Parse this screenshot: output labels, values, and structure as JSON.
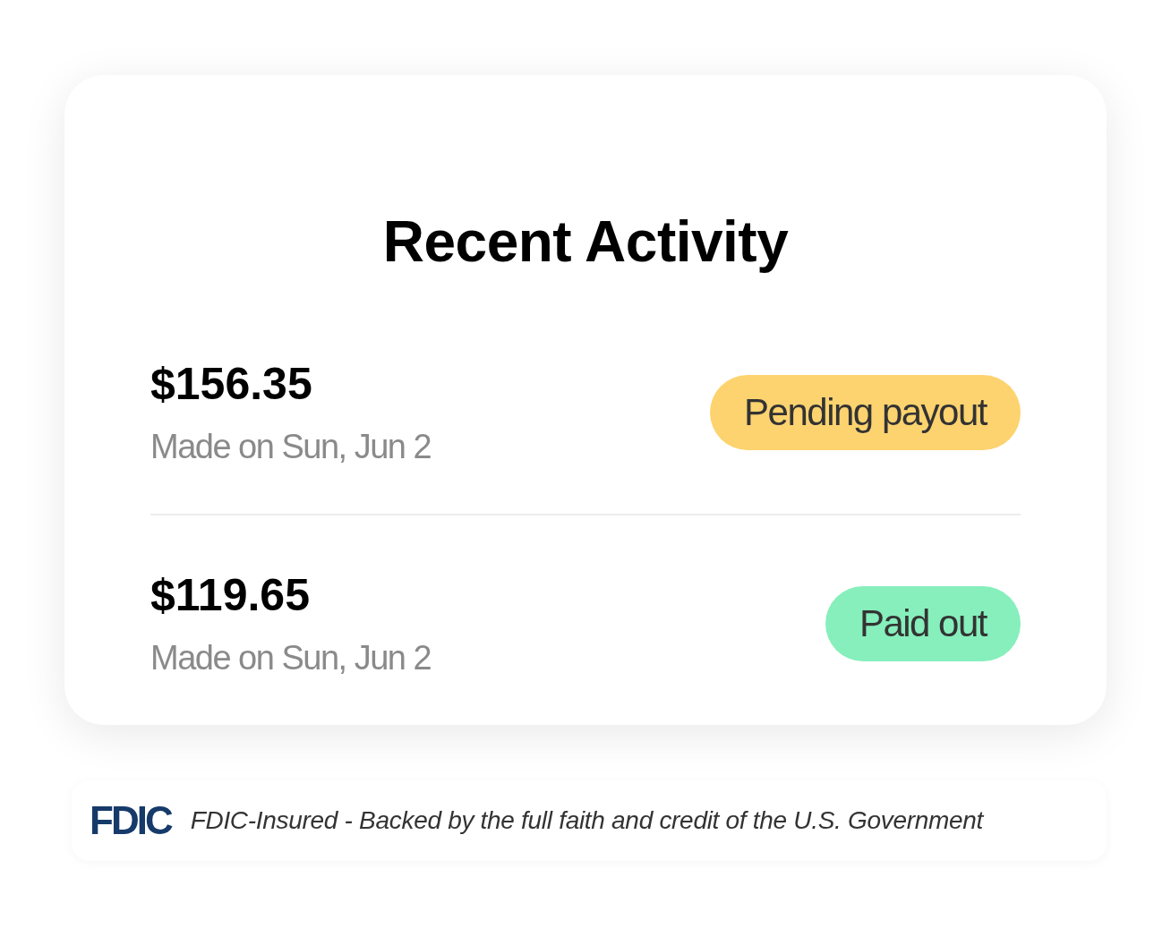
{
  "card": {
    "title": "Recent Activity",
    "activities": [
      {
        "amount": "$156.35",
        "date": "Made on Sun, Jun 2",
        "status": "Pending payout",
        "color": "#fdd36f"
      },
      {
        "amount": "$119.65",
        "date": "Made on Sun, Jun 2",
        "status": "Paid out",
        "color": "#86efbc"
      }
    ]
  },
  "footer": {
    "logo": "FDIC",
    "text": "FDIC-Insured - Backed by the full faith and credit of the U.S. Government"
  }
}
